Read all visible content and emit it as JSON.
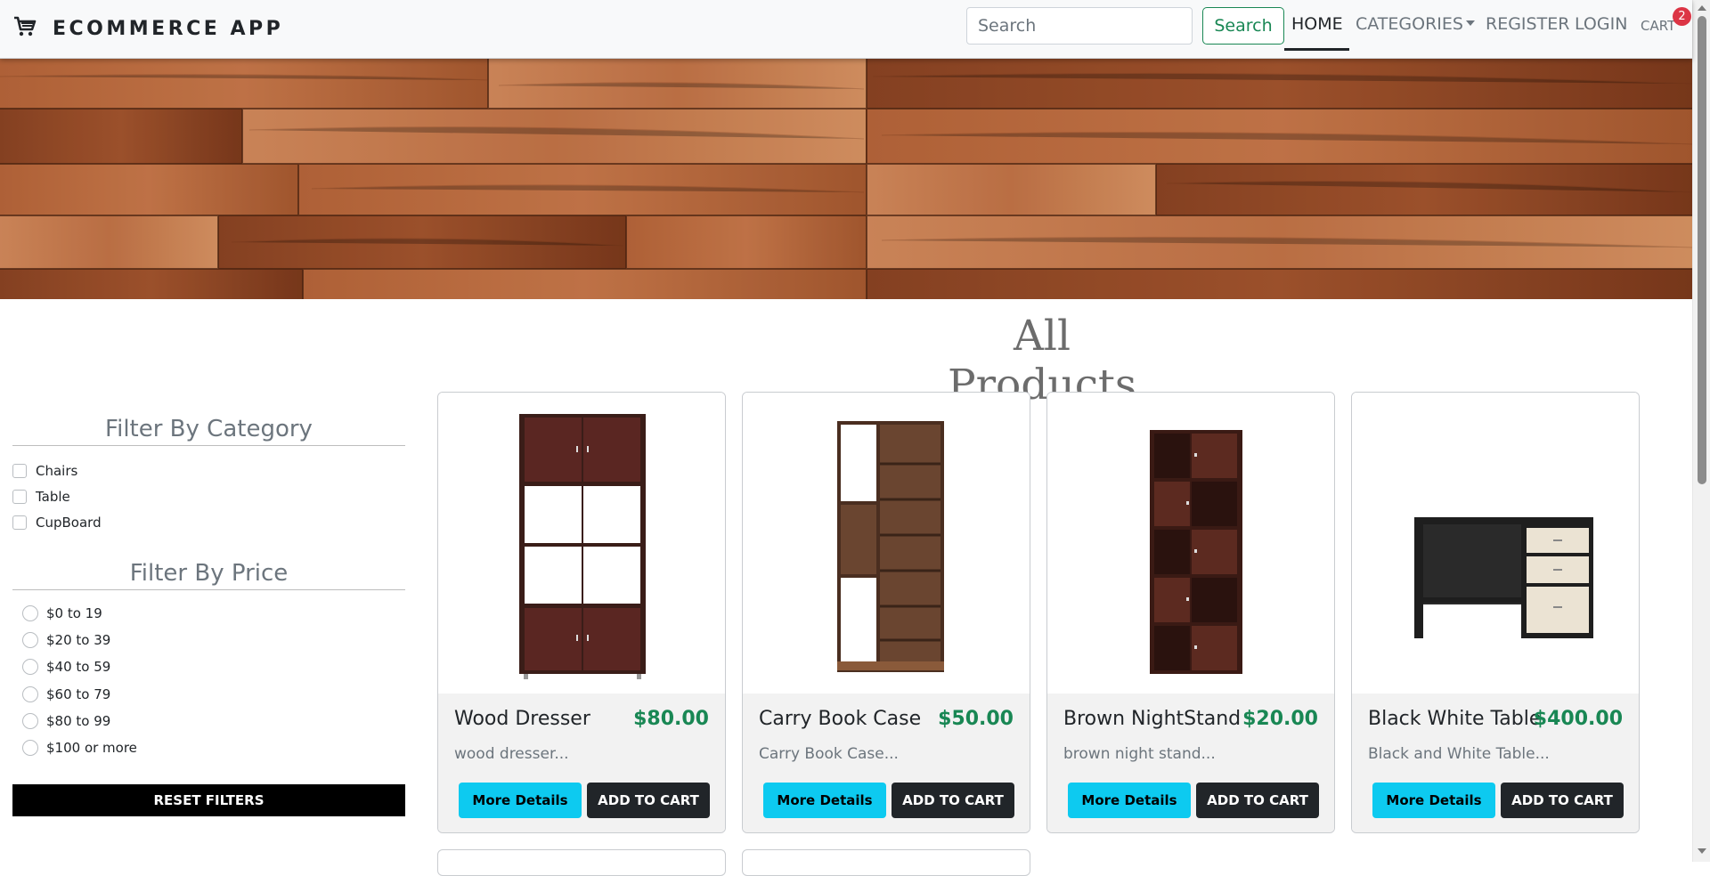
{
  "navbar": {
    "brand": "ECOMMERCE APP",
    "search_placeholder": "Search",
    "search_button": "Search",
    "links": {
      "home": "HOME",
      "categories": "CATEGORIES",
      "register": "REGISTER",
      "login": "LOGIN",
      "cart": "CART"
    },
    "cart_count": "2"
  },
  "page_title": "All Products",
  "filters": {
    "category_title": "Filter By Category",
    "categories": [
      "Chairs",
      "Table",
      "CupBoard"
    ],
    "price_title": "Filter By Price",
    "prices": [
      "$0 to 19",
      "$20 to 39",
      "$40 to 59",
      "$60 to 79",
      "$80 to 99",
      "$100 or more"
    ],
    "reset_label": "RESET FILTERS"
  },
  "products": [
    {
      "name": "Wood Dresser",
      "price": "$80.00",
      "description": "wood dresser...",
      "details_label": "More Details",
      "cart_label": "ADD TO CART"
    },
    {
      "name": "Carry Book Case",
      "price": "$50.00",
      "description": "Carry Book Case...",
      "details_label": "More Details",
      "cart_label": "ADD TO CART"
    },
    {
      "name": "Brown NightStand",
      "price": "$20.00",
      "description": "brown night stand...",
      "details_label": "More Details",
      "cart_label": "ADD TO CART"
    },
    {
      "name": "Black White Table",
      "price": "$400.00",
      "description": "Black and White Table...",
      "details_label": "More Details",
      "cart_label": "ADD TO CART"
    }
  ],
  "colors": {
    "accent_green": "#198754",
    "info_button": "#0dcaf0",
    "dark_button": "#212529",
    "badge": "#dc3545"
  }
}
